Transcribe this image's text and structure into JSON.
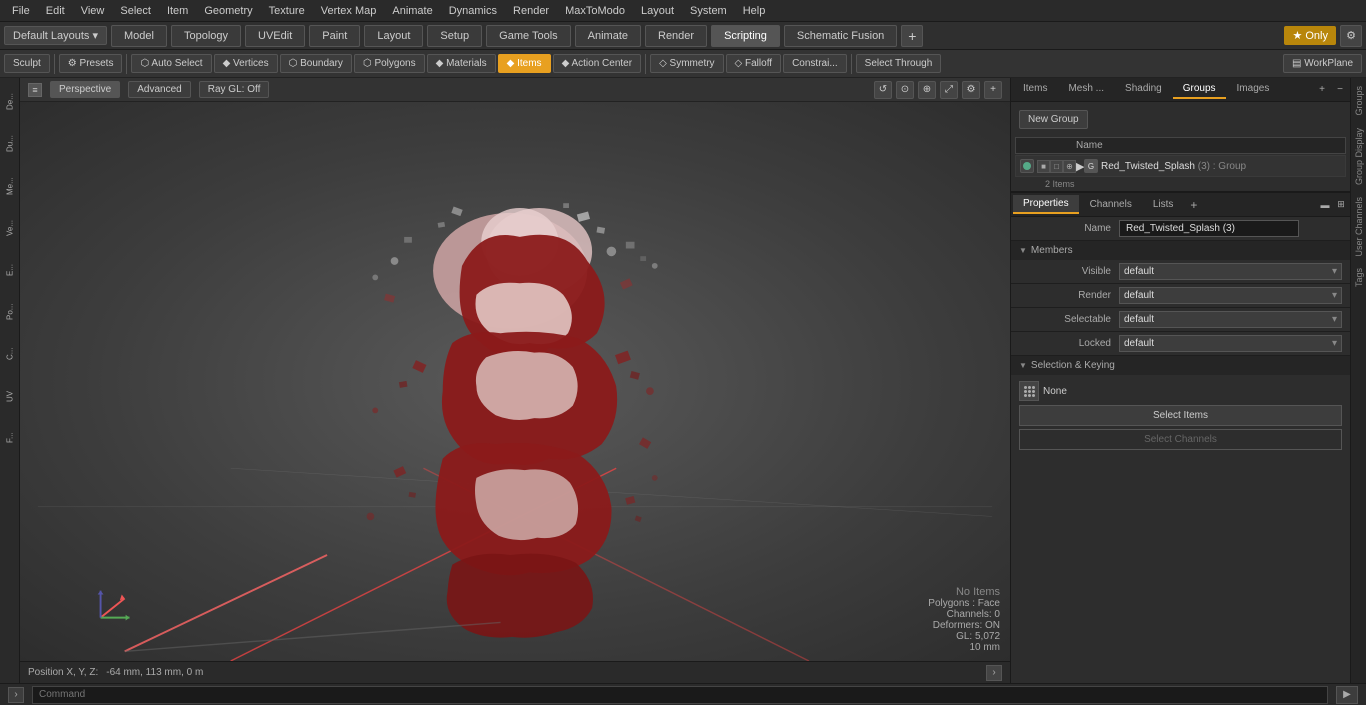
{
  "menubar": {
    "items": [
      "File",
      "Edit",
      "View",
      "Select",
      "Item",
      "Geometry",
      "Texture",
      "Vertex Map",
      "Animate",
      "Dynamics",
      "Render",
      "MaxToModo",
      "Layout",
      "System",
      "Help"
    ]
  },
  "layout_bar": {
    "dropdown": "Default Layouts ▾",
    "tabs": [
      {
        "label": "Model",
        "active": false
      },
      {
        "label": "Topology",
        "active": false
      },
      {
        "label": "UVEdit",
        "active": false
      },
      {
        "label": "Paint",
        "active": false
      },
      {
        "label": "Layout",
        "active": false
      },
      {
        "label": "Setup",
        "active": false
      },
      {
        "label": "Game Tools",
        "active": false
      },
      {
        "label": "Animate",
        "active": false
      },
      {
        "label": "Render",
        "active": false
      },
      {
        "label": "Scripting",
        "active": true
      },
      {
        "label": "Schematic Fusion",
        "active": false
      }
    ],
    "star_label": "★ Only",
    "add_icon": "+"
  },
  "toolbar": {
    "sculpt_label": "Sculpt",
    "presets_label": "⚙ Presets",
    "auto_select_label": "⬡ Auto Select",
    "vertices_label": "◆ Vertices",
    "boundary_label": "⬡ Boundary",
    "polygons_label": "⬡ Polygons",
    "materials_label": "◆ Materials",
    "items_label": "◆ Items",
    "action_center_label": "◆ Action Center",
    "symmetry_label": "◇ Symmetry",
    "falloff_label": "◇ Falloff",
    "constraints_label": "Constrai...",
    "select_through_label": "Select Through",
    "workplane_label": "▤ WorkPlane"
  },
  "viewport": {
    "mode_tabs": [
      "Perspective",
      "Advanced",
      "Ray GL: Off"
    ],
    "status": {
      "position_label": "Position X, Y, Z:",
      "position_value": "-64 mm, 113 mm, 0 m",
      "no_items": "No Items",
      "polygons": "Polygons : Face",
      "channels": "Channels: 0",
      "deformers": "Deformers: ON",
      "gl": "GL: 5,072",
      "size": "10 mm"
    }
  },
  "sidebar": {
    "items": [
      "De...",
      "Du...",
      "Me...",
      "Ve...",
      "E...",
      "Po...",
      "C...",
      "UV",
      "F..."
    ]
  },
  "panel": {
    "tabs": [
      "Items",
      "Mesh ...",
      "Shading",
      "Groups",
      "Images"
    ],
    "active_tab": "Groups",
    "new_group_btn": "New Group",
    "name_header": "Name",
    "group_name": "Red_Twisted_Splash",
    "group_suffix": "(3) : Group",
    "group_items": "2 Items"
  },
  "properties": {
    "tabs": [
      "Properties",
      "Channels",
      "Lists"
    ],
    "add_tab": "+",
    "active_tab": "Properties",
    "name_label": "Name",
    "name_value": "Red_Twisted_Splash (3)",
    "members_section": "Members",
    "visible_label": "Visible",
    "visible_value": "default",
    "render_label": "Render",
    "render_value": "default",
    "selectable_label": "Selectable",
    "selectable_value": "default",
    "locked_label": "Locked",
    "locked_value": "default",
    "selection_keying_section": "Selection & Keying",
    "none_label": "None",
    "select_items_btn": "Select Items",
    "select_channels_btn": "Select Channels"
  },
  "right_vtabs": [
    "Groups",
    "Group Display",
    "User Channels",
    "Tags"
  ],
  "bottom_bar": {
    "command_placeholder": "Command",
    "run_btn": "▶"
  }
}
